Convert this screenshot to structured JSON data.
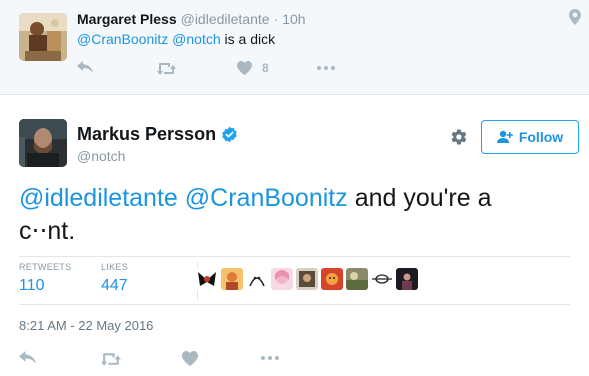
{
  "parent_tweet": {
    "author_name": "Margaret Pless",
    "author_handle": "@idlediletante",
    "time_ago": "10h",
    "text_mention_1": "@CranBoonitz",
    "text_mention_2": "@notch",
    "text_rest": "is a dick",
    "like_count": "8",
    "icons": [
      "reply-icon",
      "retweet-icon",
      "heart-icon",
      "more-icon",
      "location-pin-icon"
    ]
  },
  "main_tweet": {
    "author_name": "Markus Persson",
    "author_handle": "@notch",
    "verified": true,
    "follow_label": "Follow",
    "text_mention_1": "@idlediletante",
    "text_mention_2": "@CranBoonitz",
    "text_rest": "and you're a",
    "text_line2": "c⋅⋅nt.",
    "stats": [
      {
        "label": "RETWEETS",
        "value": "110"
      },
      {
        "label": "LIKES",
        "value": "447"
      }
    ],
    "liker_count_shown": 9,
    "timestamp": "8:21 AM - 22 May 2016",
    "icons": [
      "reply-icon",
      "retweet-icon",
      "heart-icon",
      "more-icon",
      "gear-icon",
      "follow-person-icon",
      "verified-badge-icon"
    ]
  },
  "colors": {
    "accent": "#1b95e0",
    "muted": "#8899a6",
    "icon_gray": "#aab8c2",
    "parent_bg": "#f5f8fa",
    "verified": "#1da1f2"
  }
}
